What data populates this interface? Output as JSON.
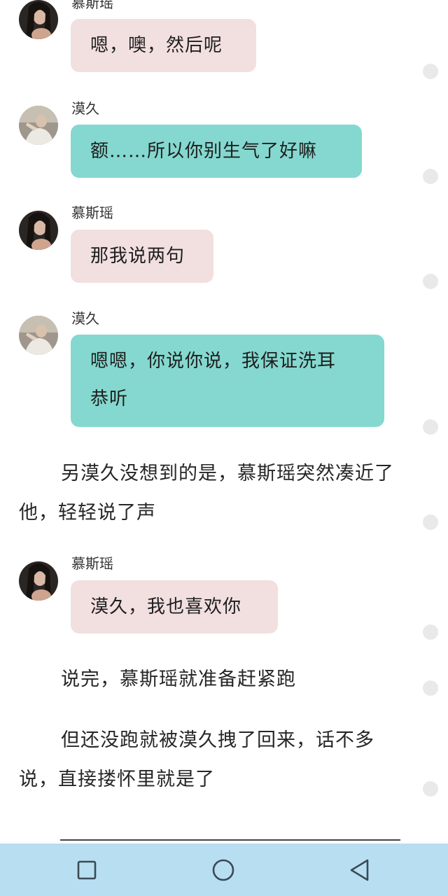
{
  "messages": [
    {
      "sender": "慕斯瑶",
      "text": "嗯，噢，然后呢",
      "color": "pink"
    },
    {
      "sender": "漠久",
      "text": "额……所以你别生气了好嘛",
      "color": "teal"
    },
    {
      "sender": "慕斯瑶",
      "text": "那我说两句",
      "color": "pink"
    },
    {
      "sender": "漠久",
      "text_line1": "嗯嗯，你说你说，我保证洗耳",
      "text_line2": "恭听",
      "color": "teal"
    },
    {
      "sender": "慕斯瑶",
      "text": "漠久，我也喜欢你",
      "color": "pink"
    }
  ],
  "narration": [
    "另漠久没想到的是，慕斯瑶突然凑近了他，轻轻说了声",
    "说完，慕斯瑶就准备赶紧跑",
    "但还没跑就被漠久拽了回来，话不多说，直接搂怀里就是了"
  ],
  "colors": {
    "pink_bubble": "#f2dfe0",
    "teal_bubble": "#84d8cf",
    "nav_bar": "#b8def2"
  },
  "icons": {
    "recent_apps": "square-icon",
    "home": "circle-icon",
    "back": "triangle-back-icon"
  }
}
